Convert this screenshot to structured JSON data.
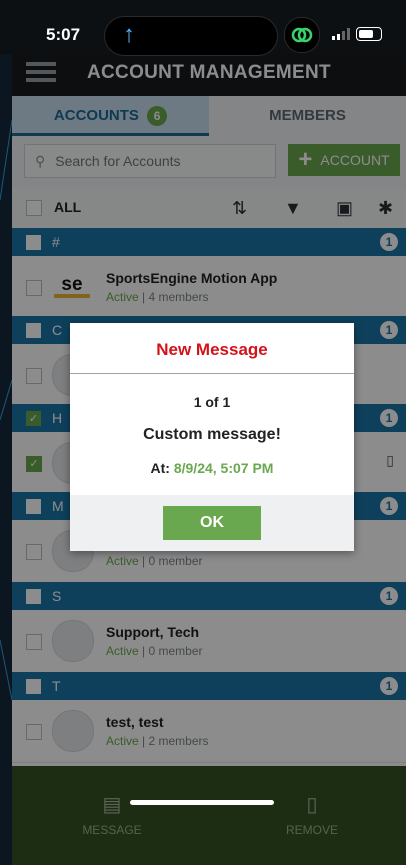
{
  "status": {
    "time": "5:07"
  },
  "header": {
    "title": "ACCOUNT MANAGEMENT"
  },
  "tabs": [
    {
      "label": "ACCOUNTS",
      "badge": "6"
    },
    {
      "label": "MEMBERS"
    }
  ],
  "search": {
    "placeholder": "Search for Accounts",
    "add_label": "ACCOUNT"
  },
  "toolbar": {
    "all_label": "ALL"
  },
  "groups": [
    {
      "letter": "#",
      "count": "1"
    },
    {
      "letter": "C",
      "count": "1"
    },
    {
      "letter": "H",
      "count": "1"
    },
    {
      "letter": "M",
      "count": "1"
    },
    {
      "letter": "S",
      "count": "1"
    },
    {
      "letter": "T",
      "count": "1"
    }
  ],
  "rows": [
    {
      "name": "SportsEngine Motion App",
      "status": "Active",
      "members": "4 members"
    },
    {
      "name": "",
      "status": "",
      "members": ""
    },
    {
      "name": "",
      "status": "",
      "members": ""
    },
    {
      "name": "",
      "status": "Active",
      "members": "0 member"
    },
    {
      "name": "Support, Tech",
      "status": "Active",
      "members": "0 member"
    },
    {
      "name": "test, test",
      "status": "Active",
      "members": "2 members"
    }
  ],
  "bottom": {
    "message_label": "MESSAGE",
    "remove_label": "REMOVE"
  },
  "modal": {
    "title": "New Message",
    "count": "1 of 1",
    "message": "Custom message!",
    "at_label": "At:",
    "at_value": "8/9/24, 5:07 PM",
    "ok_label": "OK"
  },
  "colors": {
    "accent": "#6aa84f",
    "primary": "#1a76a8",
    "alert": "#d3121b"
  }
}
